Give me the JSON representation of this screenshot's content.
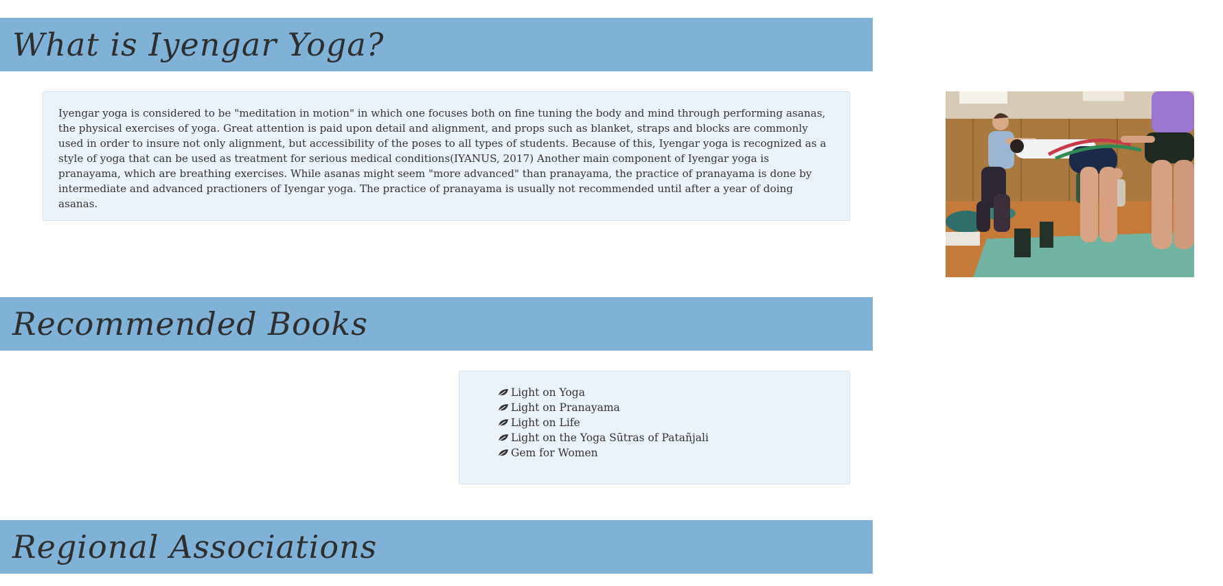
{
  "sections": {
    "what_is": {
      "title": "What is Iyengar Yoga?",
      "body": "Iyengar yoga is considered to be \"meditation in motion\" in which one focuses both on fine tuning the body and mind through performing asanas, the physical exercises of yoga. Great attention is paid upon detail and alignment, and props such as blanket, straps and blocks are commonly used in order to insure not only alignment, but accessibility of the poses to all types of students. Because of this, Iyengar yoga is recognized as a style of yoga that can be used as treatment for serious medical conditions(IYANUS, 2017) Another main component of Iyengar yoga is pranayama, which are breathing exercises. While asanas might seem \"more advanced\" than pranayama, the practice of pranayama is done by intermediate and advanced practioners of Iyengar yoga. The practice of pranayama is usually not recommended until after a year of doing asanas."
    },
    "books": {
      "title": "Recommended Books",
      "icon": "leaf-icon",
      "items": [
        "Light on Yoga",
        "Light on Pranayama",
        "Light on Life",
        "Light on the Yoga Sūtras of Patañjali",
        "Gem for Women"
      ]
    },
    "regional": {
      "title": "Regional Associations"
    }
  },
  "colors": {
    "banner": "#7fb2d6",
    "well_background": "#ebf3fa",
    "text": "#333333"
  }
}
